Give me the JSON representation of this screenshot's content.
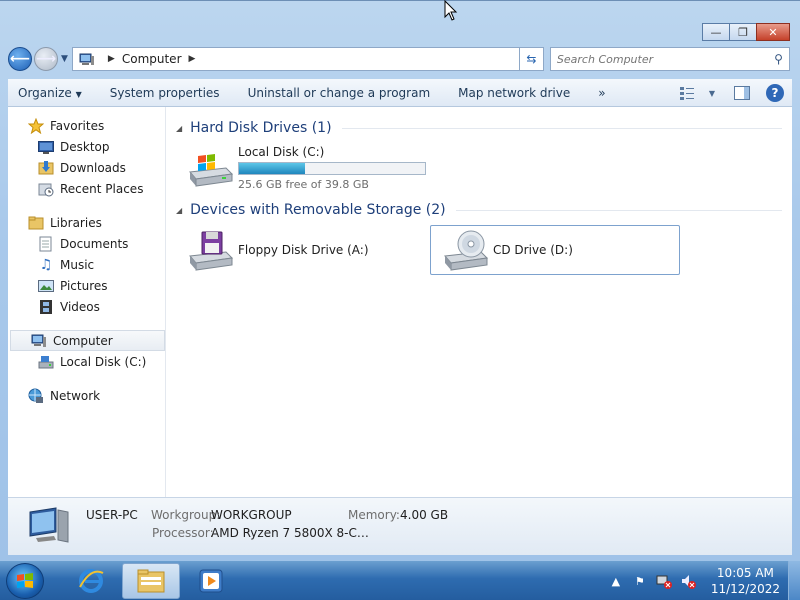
{
  "address": {
    "location": "Computer"
  },
  "search": {
    "placeholder": "Search Computer"
  },
  "toolbar": {
    "organize": "Organize",
    "system_properties": "System properties",
    "uninstall": "Uninstall or change a program",
    "map_drive": "Map network drive",
    "more": "»",
    "help": "?"
  },
  "nav": {
    "favorites": "Favorites",
    "desktop": "Desktop",
    "downloads": "Downloads",
    "recent": "Recent Places",
    "libraries": "Libraries",
    "documents": "Documents",
    "music": "Music",
    "pictures": "Pictures",
    "videos": "Videos",
    "computer": "Computer",
    "local_disk": "Local Disk (C:)",
    "network": "Network"
  },
  "groups": {
    "hdd": "Hard Disk Drives (1)",
    "removable": "Devices with Removable Storage (2)"
  },
  "drives": {
    "c": {
      "name": "Local Disk (C:)",
      "free": "25.6 GB free of 39.8 GB",
      "used_fraction": 0.357
    },
    "a": {
      "name": "Floppy Disk Drive (A:)"
    },
    "d": {
      "name": "CD Drive (D:)"
    }
  },
  "details": {
    "pc_name": "USER-PC",
    "workgroup_label": "Workgroup:",
    "workgroup_value": "WORKGROUP",
    "memory_label": "Memory:",
    "memory_value": "4.00 GB",
    "processor_label": "Processor:",
    "processor_value": "AMD Ryzen 7 5800X 8-C…"
  },
  "taskbar": {
    "time": "10:05 AM",
    "date": "11/12/2022"
  },
  "colors": {
    "accent": "#1e3f7a",
    "disk_bar": "#1f86bd"
  }
}
